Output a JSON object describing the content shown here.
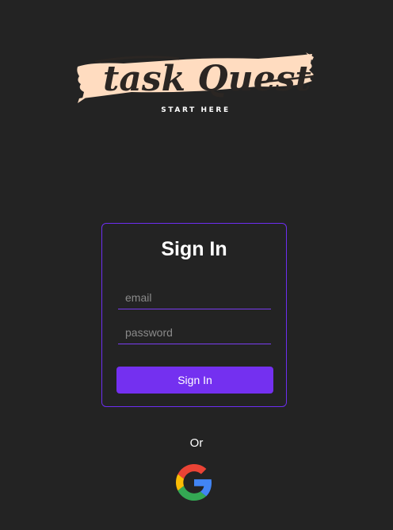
{
  "logo": {
    "title": "task Quest",
    "subtitle": "START HERE",
    "brush_color": "#ffdcc0",
    "text_color": "#2b2623"
  },
  "signin_card": {
    "title": "Sign In",
    "email_placeholder": "email",
    "email_value": "",
    "password_placeholder": "password",
    "password_value": "",
    "submit_label": "Sign In",
    "accent_color": "#7430f0"
  },
  "alt_login": {
    "or_text": "Or",
    "google_icon": "google-icon"
  },
  "colors": {
    "background": "#232323",
    "border": "#6d2ef0"
  }
}
